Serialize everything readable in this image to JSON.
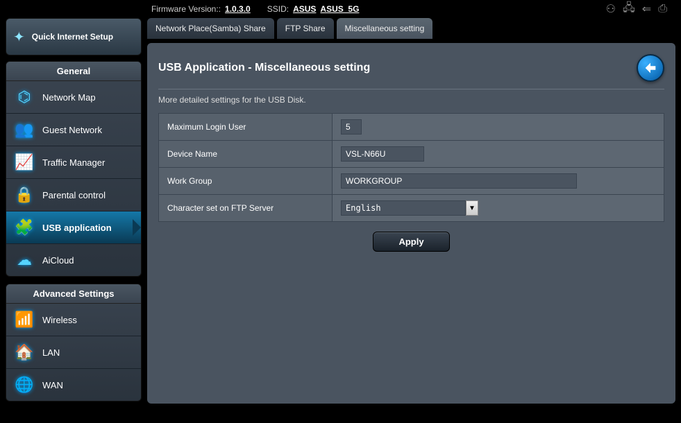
{
  "header": {
    "firmware_label": "Firmware Version::",
    "firmware_value": "1.0.3.0",
    "ssid_label": "SSID:",
    "ssid_value_1": "ASUS",
    "ssid_value_2": "ASUS_5G"
  },
  "quick_setup": "Quick Internet Setup",
  "sidebar": {
    "general_title": "General",
    "advanced_title": "Advanced Settings",
    "general": [
      {
        "label": "Network Map"
      },
      {
        "label": "Guest Network"
      },
      {
        "label": "Traffic Manager"
      },
      {
        "label": "Parental control"
      },
      {
        "label": "USB application"
      },
      {
        "label": "AiCloud"
      }
    ],
    "advanced": [
      {
        "label": "Wireless"
      },
      {
        "label": "LAN"
      },
      {
        "label": "WAN"
      }
    ]
  },
  "tabs": [
    {
      "label": "Network Place(Samba) Share"
    },
    {
      "label": "FTP Share"
    },
    {
      "label": "Miscellaneous setting"
    }
  ],
  "content": {
    "title": "USB Application - Miscellaneous setting",
    "desc": "More detailed settings for the USB Disk.",
    "fields": {
      "max_login_user_label": "Maximum Login User",
      "max_login_user_value": "5",
      "device_name_label": "Device Name",
      "device_name_value": "VSL-N66U",
      "work_group_label": "Work Group",
      "work_group_value": "WORKGROUP",
      "charset_label": "Character set on FTP Server",
      "charset_value": "English"
    },
    "apply": "Apply"
  }
}
